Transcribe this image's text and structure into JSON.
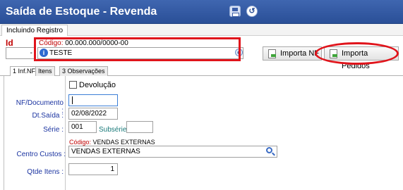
{
  "window": {
    "title": "Saída de Estoque - Revenda"
  },
  "toolbar": {
    "save_icon": "save-icon",
    "refresh_icon": "refresh-icon"
  },
  "mode_tab": "Incluindo Registro",
  "id_field": {
    "label": "Id",
    "value": "-"
  },
  "codigo": {
    "label": "Código:",
    "value": "00.000.000/0000-00"
  },
  "customer": {
    "value": "TESTE"
  },
  "buttons": {
    "import_nf": "Importa NF",
    "import_pedidos": "Importa Pedidos"
  },
  "tabs": [
    {
      "label": "1 Inf.NF"
    },
    {
      "label": "Itens"
    },
    {
      "label": "3 Observações"
    }
  ],
  "form": {
    "devolucao_label": "Devolução",
    "nf_label": "NF/Documento :",
    "nf_value": "",
    "dt_label": "Dt.Saída :",
    "dt_value": "02/08/2022",
    "serie_label": "Série :",
    "serie_value": "001",
    "subserie_label": "Subsérie :",
    "subserie_value": "",
    "cc_codigo_label": "Código:",
    "cc_codigo_value": "VENDAS EXTERNAS",
    "cc_label": "Centro Custos :",
    "cc_value": "VENDAS EXTERNAS",
    "qtd_label": "Qtde Itens :",
    "qtd_value": "1"
  },
  "colors": {
    "titlebar": "#2f58a6",
    "highlight": "#e0141b",
    "label_blue": "#1a33a0"
  }
}
